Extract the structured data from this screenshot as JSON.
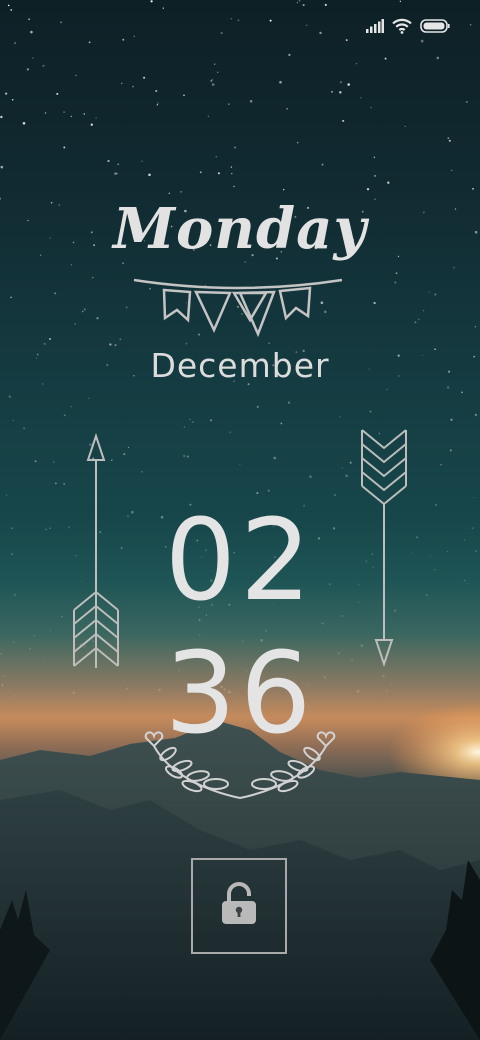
{
  "status_bar": {
    "signal_icon": "cellular-signal-icon",
    "wifi_icon": "wifi-icon",
    "battery_icon": "battery-icon"
  },
  "lockscreen": {
    "day": "Monday",
    "month": "December",
    "time": {
      "hours": "02",
      "minutes": "36"
    },
    "unlock_icon": "unlock-padlock-icon"
  },
  "colors": {
    "text": "#e4e4e4",
    "outline": "#a9a9a9",
    "sky_top": "#0d2026",
    "horizon": "#c68b5c"
  }
}
